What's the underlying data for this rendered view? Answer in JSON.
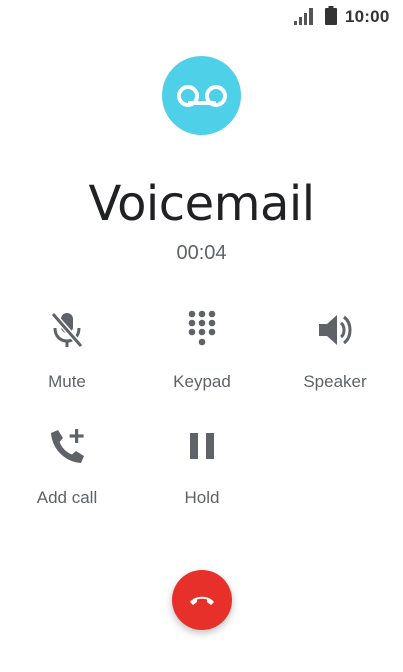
{
  "status_bar": {
    "time": "10:00"
  },
  "call": {
    "caller_name": "Voicemail",
    "duration": "00:04"
  },
  "actions": {
    "mute": "Mute",
    "keypad": "Keypad",
    "speaker": "Speaker",
    "add_call": "Add call",
    "hold": "Hold"
  },
  "colors": {
    "avatar_bg": "#4dd0e8",
    "end_call_bg": "#e8302b",
    "icon_gray": "#5f6368"
  }
}
